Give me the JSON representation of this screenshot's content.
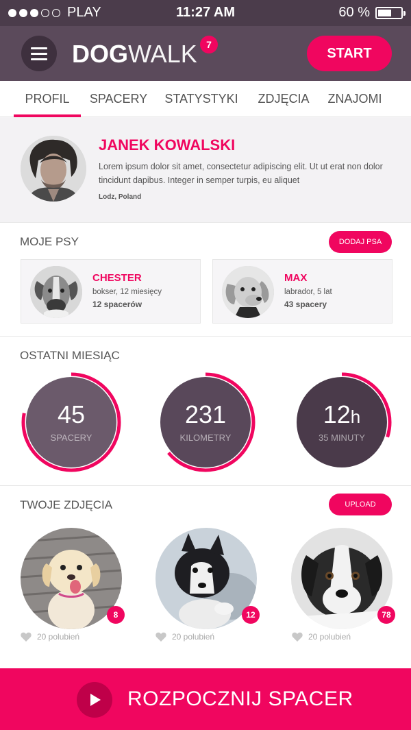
{
  "status_bar": {
    "carrier": "PLAY",
    "signal": "3 of 5",
    "time": "11:27 AM",
    "battery": "60 %",
    "battery_level": 0.6
  },
  "header": {
    "logo_bold": "DOG",
    "logo_light": "WALK",
    "notification_count": "7",
    "start_label": "START",
    "menu_icon": "hamburger-menu-icon"
  },
  "tabs": [
    {
      "label": "PROFIL",
      "active": true
    },
    {
      "label": "SPACERY",
      "active": false
    },
    {
      "label": "STATYSTYKI",
      "active": false
    },
    {
      "label": "ZDJĘCIA",
      "active": false
    },
    {
      "label": "ZNAJOMI",
      "active": false
    }
  ],
  "profile": {
    "name": "JANEK KOWALSKI",
    "bio": "Lorem ipsum dolor sit amet, consectetur adipiscing elit. Ut ut erat non dolor tincidunt dapibus. Integer in semper turpis, eu aliquet",
    "location": "Lodz, Poland"
  },
  "dogs_section": {
    "title": "MOJE PSY",
    "add_label": "DODAJ PSA",
    "dogs": [
      {
        "name": "CHESTER",
        "breed": "bokser,  12 miesięcy",
        "walks": "12 spacerów"
      },
      {
        "name": "MAX",
        "breed": "labrador, 5 lat",
        "walks": "43 spacery"
      }
    ]
  },
  "stats_section": {
    "title": "OSTATNI MIESIĄC",
    "stats": [
      {
        "value": "45",
        "unit": "",
        "label": "SPACERY",
        "progress": 0.78,
        "color": "#6b5a6b"
      },
      {
        "value": "231",
        "unit": "",
        "label": "KILOMETRY",
        "progress": 0.64,
        "color": "#59485a"
      },
      {
        "value": "12",
        "unit": "h",
        "label": "35 MINUTY",
        "progress": 0.3,
        "color": "#4a3a4a"
      }
    ],
    "ring_color": "#f0065f"
  },
  "photos_section": {
    "title": "TWOJE ZDJĘCIA",
    "upload_label": "UPLOAD",
    "photos": [
      {
        "badge": "8",
        "likes": "20 polubień"
      },
      {
        "badge": "12",
        "likes": "20 polubień"
      },
      {
        "badge": "78",
        "likes": "20 polubień"
      }
    ]
  },
  "cta": {
    "label": "ROZPOCZNIJ SPACER",
    "icon": "play-icon"
  },
  "colors": {
    "accent": "#f0065f",
    "header": "#5b4a5b",
    "statusbar": "#4b3c4b"
  }
}
